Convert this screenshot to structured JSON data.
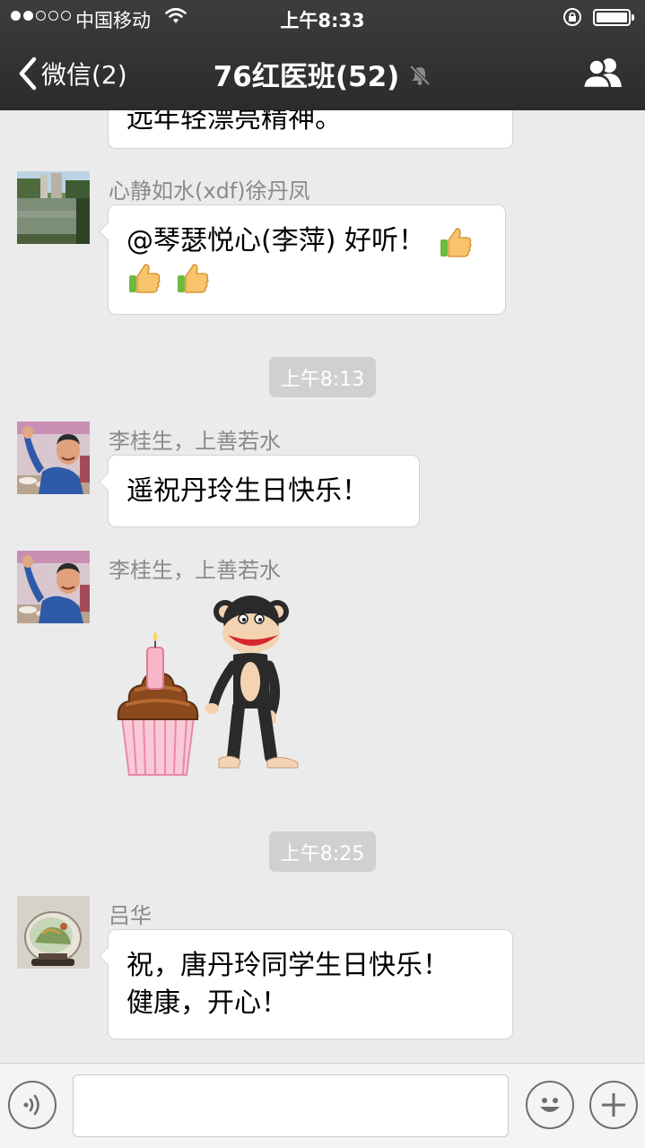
{
  "status_bar": {
    "carrier": "中国移动",
    "time": "上午8:33",
    "signal_bars": 2,
    "signal_total": 5,
    "battery_level": 1.0
  },
  "nav": {
    "back_label": "微信(2)",
    "title": "76红医班(52)",
    "muted": true,
    "icons": {
      "back": "chevron-left-icon",
      "mute": "bell-off-icon",
      "members": "group-members-icon"
    }
  },
  "messages": [
    {
      "kind": "text",
      "text_line1": "远年轻漂亮精神。"
    },
    {
      "kind": "text",
      "sender": "心静如水(xdf)徐丹凤",
      "text_line1": "@琴瑟悦心(李萍) 好听！",
      "emoji": "thumbs-up-icon",
      "emoji_count": 3
    },
    {
      "kind": "timestamp",
      "text": "上午8:13"
    },
    {
      "kind": "text",
      "sender": "李桂生，上善若水",
      "text_line1": "遥祝丹玲生日快乐！"
    },
    {
      "kind": "sticker",
      "sender": "李桂生，上善若水",
      "sticker": "cupcake-monkey-sticker"
    },
    {
      "kind": "timestamp",
      "text": "上午8:25"
    },
    {
      "kind": "text",
      "sender": "吕华",
      "text_line1": "祝，唐丹玲同学生日快乐！",
      "text_line2": "健康，开心！"
    }
  ],
  "input_bar": {
    "value": "",
    "icons": {
      "voice": "voice-icon",
      "emoji": "smiley-icon",
      "more": "plus-icon"
    }
  },
  "colors": {
    "header_bg": "#2f2f31",
    "chat_bg": "#ebebeb",
    "bubble_bg": "#ffffff",
    "timestamp_bg": "#d0d0d0",
    "sender_text": "#8a8a8a"
  }
}
